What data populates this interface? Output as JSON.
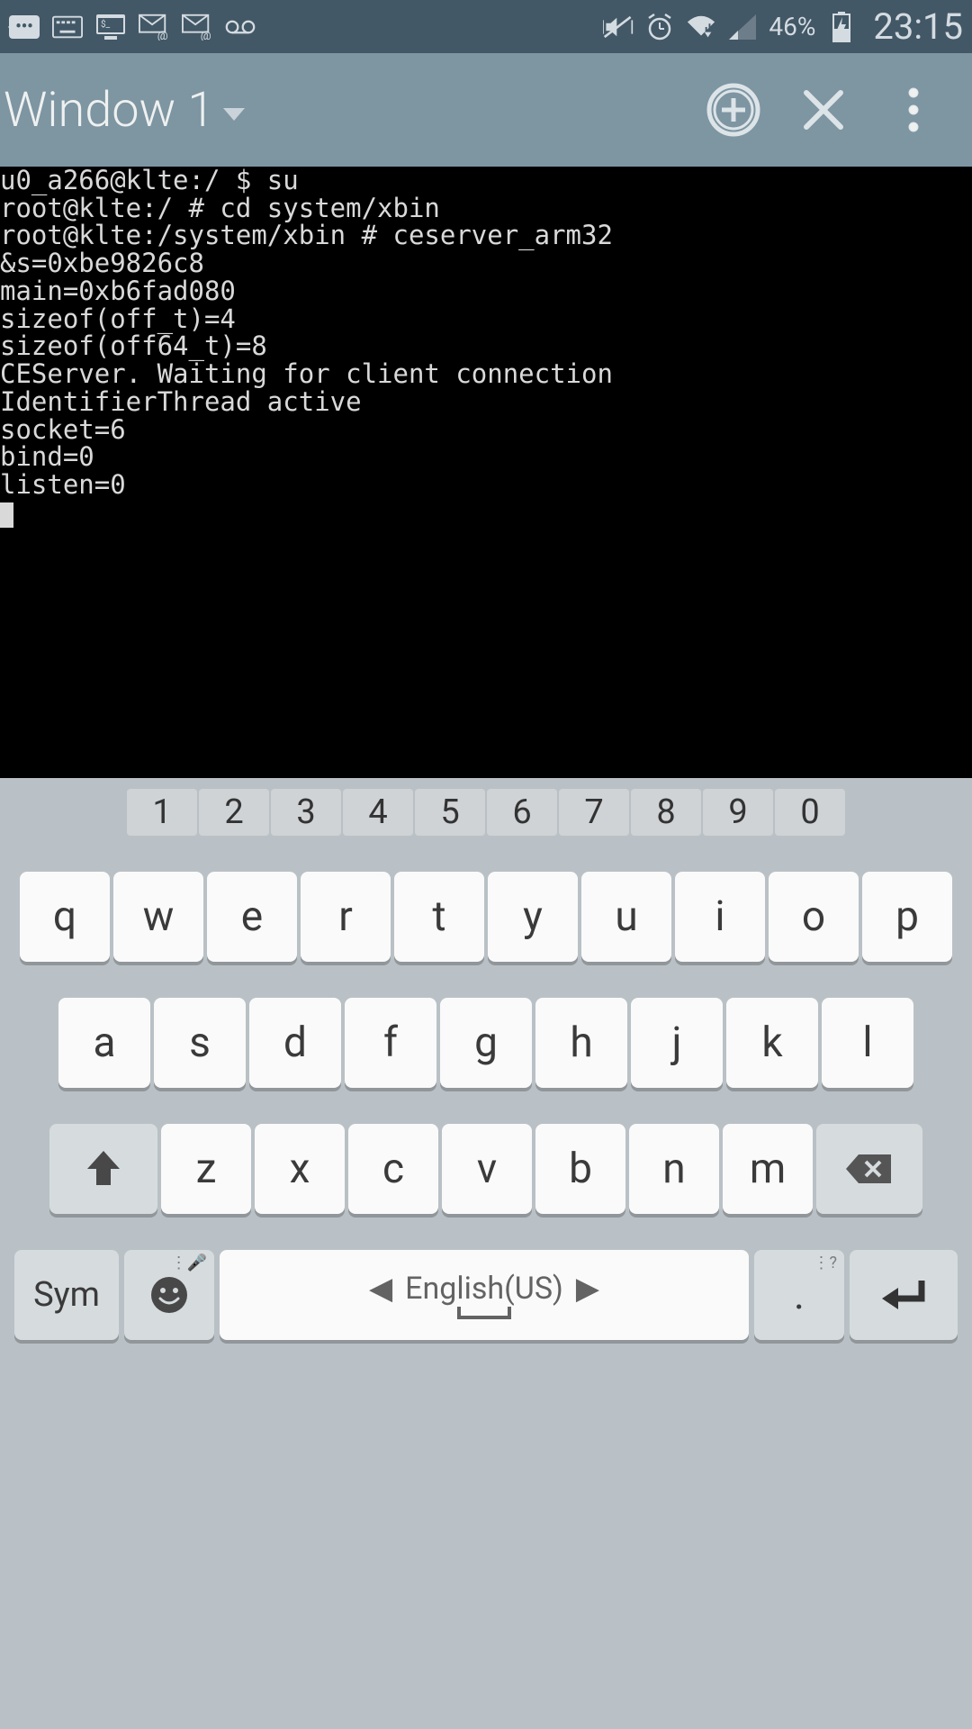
{
  "status_bar": {
    "battery_pct": "46%",
    "time": "23:15"
  },
  "header": {
    "window_title": "Window 1"
  },
  "terminal": {
    "lines": [
      "u0_a266@klte:/ $ su",
      "root@klte:/ # cd system/xbin",
      "root@klte:/system/xbin # ceserver_arm32",
      "&s=0xbe9826c8",
      "main=0xb6fad080",
      "sizeof(off_t)=4",
      "sizeof(off64_t)=8",
      "CEServer. Waiting for client connection",
      "IdentifierThread active",
      "socket=6",
      "bind=0",
      "listen=0"
    ]
  },
  "keyboard": {
    "row_numbers": [
      "1",
      "2",
      "3",
      "4",
      "5",
      "6",
      "7",
      "8",
      "9",
      "0"
    ],
    "row_q": [
      "q",
      "w",
      "e",
      "r",
      "t",
      "y",
      "u",
      "i",
      "o",
      "p"
    ],
    "row_a": [
      "a",
      "s",
      "d",
      "f",
      "g",
      "h",
      "j",
      "k",
      "l"
    ],
    "row_z": [
      "z",
      "x",
      "c",
      "v",
      "b",
      "n",
      "m"
    ],
    "sym_label": "Sym",
    "space_label": "English(US)",
    "period_label": ".",
    "emoji_hint": "",
    "period_hint": "?"
  }
}
